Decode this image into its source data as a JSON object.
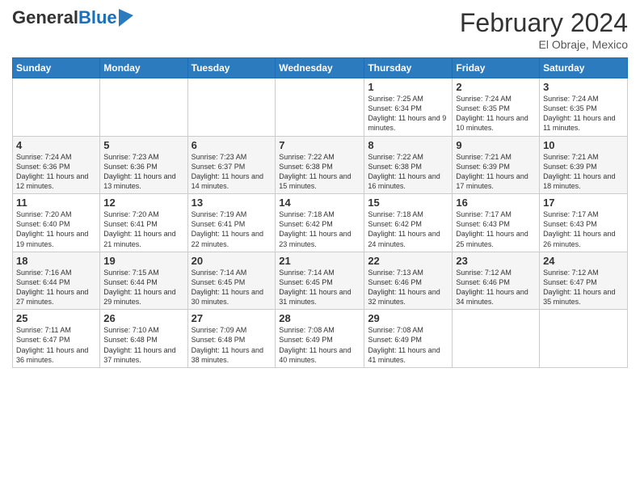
{
  "header": {
    "logo_general": "General",
    "logo_blue": "Blue",
    "month_year": "February 2024",
    "location": "El Obraje, Mexico"
  },
  "days_of_week": [
    "Sunday",
    "Monday",
    "Tuesday",
    "Wednesday",
    "Thursday",
    "Friday",
    "Saturday"
  ],
  "weeks": [
    [
      {
        "day": "",
        "info": ""
      },
      {
        "day": "",
        "info": ""
      },
      {
        "day": "",
        "info": ""
      },
      {
        "day": "",
        "info": ""
      },
      {
        "day": "1",
        "info": "Sunrise: 7:25 AM\nSunset: 6:34 PM\nDaylight: 11 hours and 9 minutes."
      },
      {
        "day": "2",
        "info": "Sunrise: 7:24 AM\nSunset: 6:35 PM\nDaylight: 11 hours and 10 minutes."
      },
      {
        "day": "3",
        "info": "Sunrise: 7:24 AM\nSunset: 6:35 PM\nDaylight: 11 hours and 11 minutes."
      }
    ],
    [
      {
        "day": "4",
        "info": "Sunrise: 7:24 AM\nSunset: 6:36 PM\nDaylight: 11 hours and 12 minutes."
      },
      {
        "day": "5",
        "info": "Sunrise: 7:23 AM\nSunset: 6:36 PM\nDaylight: 11 hours and 13 minutes."
      },
      {
        "day": "6",
        "info": "Sunrise: 7:23 AM\nSunset: 6:37 PM\nDaylight: 11 hours and 14 minutes."
      },
      {
        "day": "7",
        "info": "Sunrise: 7:22 AM\nSunset: 6:38 PM\nDaylight: 11 hours and 15 minutes."
      },
      {
        "day": "8",
        "info": "Sunrise: 7:22 AM\nSunset: 6:38 PM\nDaylight: 11 hours and 16 minutes."
      },
      {
        "day": "9",
        "info": "Sunrise: 7:21 AM\nSunset: 6:39 PM\nDaylight: 11 hours and 17 minutes."
      },
      {
        "day": "10",
        "info": "Sunrise: 7:21 AM\nSunset: 6:39 PM\nDaylight: 11 hours and 18 minutes."
      }
    ],
    [
      {
        "day": "11",
        "info": "Sunrise: 7:20 AM\nSunset: 6:40 PM\nDaylight: 11 hours and 19 minutes."
      },
      {
        "day": "12",
        "info": "Sunrise: 7:20 AM\nSunset: 6:41 PM\nDaylight: 11 hours and 21 minutes."
      },
      {
        "day": "13",
        "info": "Sunrise: 7:19 AM\nSunset: 6:41 PM\nDaylight: 11 hours and 22 minutes."
      },
      {
        "day": "14",
        "info": "Sunrise: 7:18 AM\nSunset: 6:42 PM\nDaylight: 11 hours and 23 minutes."
      },
      {
        "day": "15",
        "info": "Sunrise: 7:18 AM\nSunset: 6:42 PM\nDaylight: 11 hours and 24 minutes."
      },
      {
        "day": "16",
        "info": "Sunrise: 7:17 AM\nSunset: 6:43 PM\nDaylight: 11 hours and 25 minutes."
      },
      {
        "day": "17",
        "info": "Sunrise: 7:17 AM\nSunset: 6:43 PM\nDaylight: 11 hours and 26 minutes."
      }
    ],
    [
      {
        "day": "18",
        "info": "Sunrise: 7:16 AM\nSunset: 6:44 PM\nDaylight: 11 hours and 27 minutes."
      },
      {
        "day": "19",
        "info": "Sunrise: 7:15 AM\nSunset: 6:44 PM\nDaylight: 11 hours and 29 minutes."
      },
      {
        "day": "20",
        "info": "Sunrise: 7:14 AM\nSunset: 6:45 PM\nDaylight: 11 hours and 30 minutes."
      },
      {
        "day": "21",
        "info": "Sunrise: 7:14 AM\nSunset: 6:45 PM\nDaylight: 11 hours and 31 minutes."
      },
      {
        "day": "22",
        "info": "Sunrise: 7:13 AM\nSunset: 6:46 PM\nDaylight: 11 hours and 32 minutes."
      },
      {
        "day": "23",
        "info": "Sunrise: 7:12 AM\nSunset: 6:46 PM\nDaylight: 11 hours and 34 minutes."
      },
      {
        "day": "24",
        "info": "Sunrise: 7:12 AM\nSunset: 6:47 PM\nDaylight: 11 hours and 35 minutes."
      }
    ],
    [
      {
        "day": "25",
        "info": "Sunrise: 7:11 AM\nSunset: 6:47 PM\nDaylight: 11 hours and 36 minutes."
      },
      {
        "day": "26",
        "info": "Sunrise: 7:10 AM\nSunset: 6:48 PM\nDaylight: 11 hours and 37 minutes."
      },
      {
        "day": "27",
        "info": "Sunrise: 7:09 AM\nSunset: 6:48 PM\nDaylight: 11 hours and 38 minutes."
      },
      {
        "day": "28",
        "info": "Sunrise: 7:08 AM\nSunset: 6:49 PM\nDaylight: 11 hours and 40 minutes."
      },
      {
        "day": "29",
        "info": "Sunrise: 7:08 AM\nSunset: 6:49 PM\nDaylight: 11 hours and 41 minutes."
      },
      {
        "day": "",
        "info": ""
      },
      {
        "day": "",
        "info": ""
      }
    ]
  ]
}
